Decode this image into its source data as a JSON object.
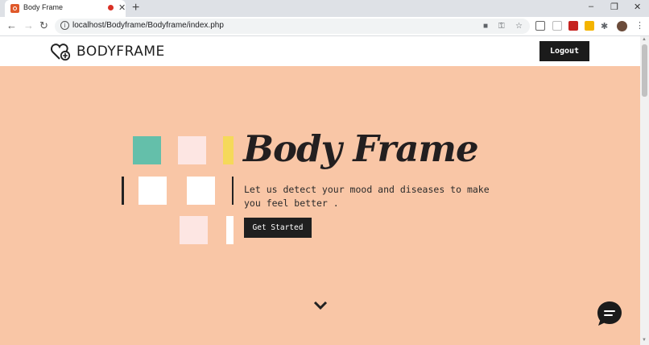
{
  "browser": {
    "tab_title": "Body Frame",
    "url": "localhost/Bodyframe/Bodyframe/index.php",
    "new_tab": "+",
    "tab_close": "✕",
    "window_controls": [
      "–",
      "❐",
      "✕"
    ]
  },
  "header": {
    "logo_text": "BODYFRAME",
    "logout_label": "Logout"
  },
  "hero": {
    "title": "Body Frame",
    "subtitle": "Let us detect your mood and diseases to make you feel better .",
    "cta_label": "Get Started"
  },
  "colors": {
    "hero_bg": "#f9c6a6",
    "teal": "#64bfaa",
    "pale_pink": "#fde6e3",
    "yellow": "#f5d95a",
    "dark": "#1b1b1b"
  },
  "icons": [
    "logo-heart-icon",
    "chevron-down-icon",
    "chat-icon",
    "info-icon",
    "camera-icon",
    "key-icon",
    "star-icon",
    "puzzle-icon",
    "menu-kebab-icon"
  ]
}
